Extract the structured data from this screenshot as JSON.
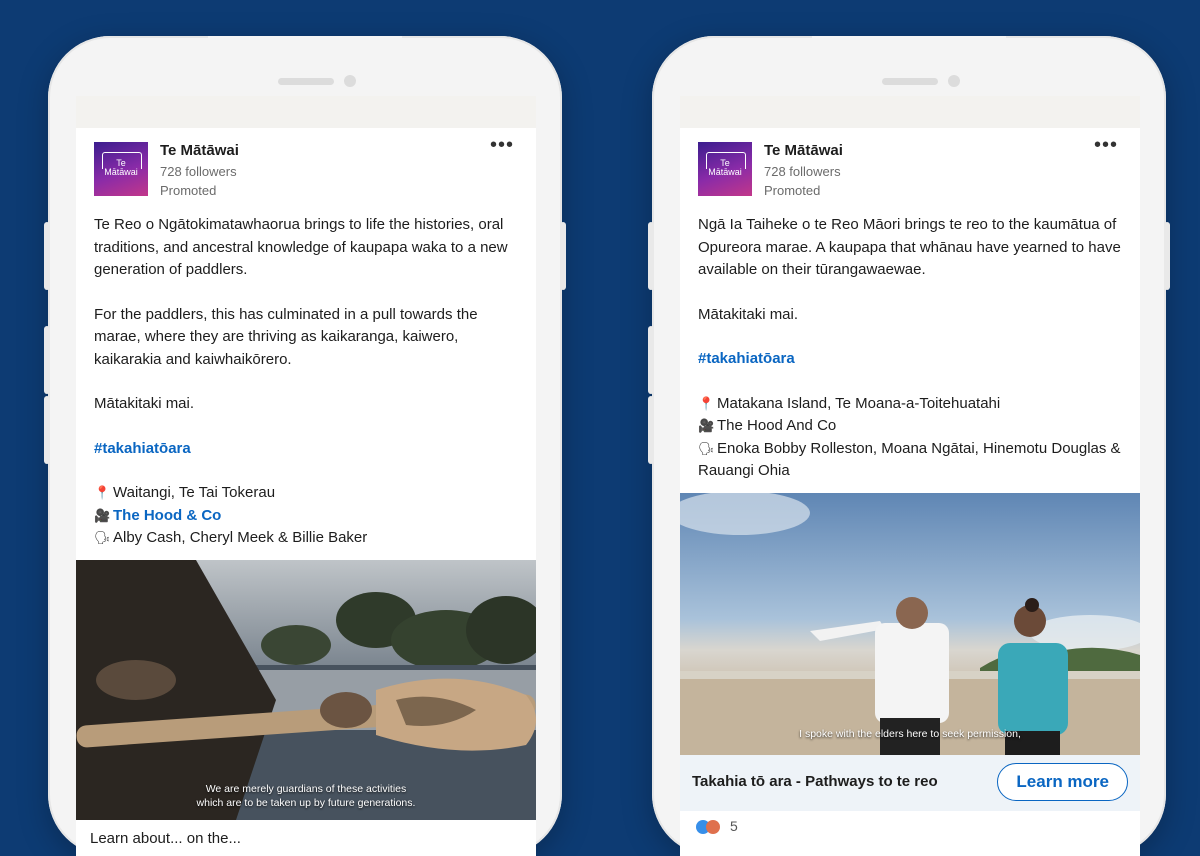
{
  "left_post": {
    "author": "Te Mātāwai",
    "followers": "728 followers",
    "promoted": "Promoted",
    "logo_text": "Te Mātāwai",
    "paragraph1": "Te Reo o Ngātokimatawhaorua brings to life the histories, oral traditions, and ancestral knowledge of kaupapa waka to a new generation of paddlers.",
    "paragraph2": "For the paddlers, this has culminated in a pull towards the marae, where they are thriving as kaikaranga, kaiwero, kaikarakia and kaiwhaikōrero.",
    "call": "Mātakitaki mai.",
    "hashtag": "#takahiatōara",
    "location": "Waitangi, Te Tai Tokerau",
    "production": "The Hood & Co",
    "speakers": "Alby Cash, Cheryl Meek & Billie Baker",
    "video_caption_line1": "We are merely guardians of these activities",
    "video_caption_line2": "which are to be taken up by future generations.",
    "bottom_text": "Learn about... on the..."
  },
  "right_post": {
    "author": "Te Mātāwai",
    "followers": "728 followers",
    "promoted": "Promoted",
    "logo_text": "Te Mātāwai",
    "paragraph1": "Ngā Ia Taiheke o te Reo Māori brings te reo to the kaumātua of Opureora marae. A kaupapa that whānau have yearned to have available on their tūrangawaewae.",
    "call": "Mātakitaki mai.",
    "hashtag": "#takahiatōara",
    "location": "Matakana Island, Te Moana-a-Toitehuatahi",
    "production": "The Hood And Co",
    "speakers": "Enoka Bobby Rolleston, Moana Ngātai, Hinemotu Douglas & Rauangi Ohia",
    "video_caption": "I spoke with the elders here to seek permission,",
    "cta_title": "Takahia tō ara - Pathways to te reo",
    "cta_button": "Learn more",
    "reaction_count": "5"
  },
  "icons": {
    "location": "pin-icon",
    "production": "camera-icon",
    "speakers": "speaking-head-icon",
    "more": "more-options-icon"
  },
  "colors": {
    "background": "#0d3b73",
    "link": "#0a66c2",
    "cta_bar": "#eef3f8"
  }
}
